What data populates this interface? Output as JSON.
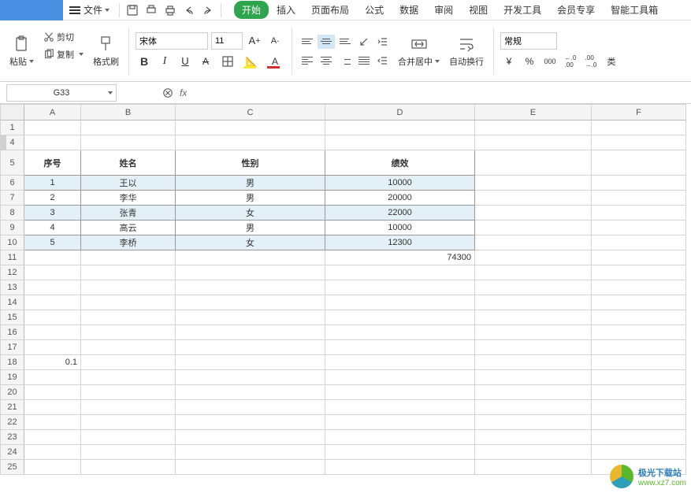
{
  "menu": {
    "file": "文件",
    "tabs": [
      "开始",
      "插入",
      "页面布局",
      "公式",
      "数据",
      "审阅",
      "视图",
      "开发工具",
      "会员专享",
      "智能工具箱"
    ]
  },
  "clipboard": {
    "paste": "粘贴",
    "cut": "剪切",
    "copy": "复制",
    "format_painter": "格式刷"
  },
  "font": {
    "name": "宋体",
    "size": "11",
    "bold": "B",
    "italic": "I",
    "underline": "U",
    "font_a": "A"
  },
  "cells": {
    "merge_center": "合并居中",
    "wrap_text": "自动换行"
  },
  "number": {
    "format": "常规",
    "currency": "¥",
    "percent": "%",
    "comma": "000",
    "inc_dec": ".00",
    "dec_dec": ".0",
    "type_label": "类"
  },
  "formula_bar": {
    "cell_ref": "G33",
    "fx": "fx",
    "value": ""
  },
  "columns": [
    "A",
    "B",
    "C",
    "D",
    "E",
    "F"
  ],
  "header_row": {
    "seq": "序号",
    "name": "姓名",
    "gender": "性别",
    "perf": "绩效"
  },
  "rows": [
    {
      "n": "1",
      "name": "王以",
      "gender": "男",
      "perf": "10000",
      "shaded": true
    },
    {
      "n": "2",
      "name": "李华",
      "gender": "男",
      "perf": "20000",
      "shaded": false
    },
    {
      "n": "3",
      "name": "张青",
      "gender": "女",
      "perf": "22000",
      "shaded": true
    },
    {
      "n": "4",
      "name": "高云",
      "gender": "男",
      "perf": "10000",
      "shaded": false
    },
    {
      "n": "5",
      "name": "李桥",
      "gender": "女",
      "perf": "12300",
      "shaded": true
    }
  ],
  "sum": "74300",
  "a18": "0.1",
  "watermark": {
    "title": "极光下载站",
    "url": "www.xz7.com"
  }
}
